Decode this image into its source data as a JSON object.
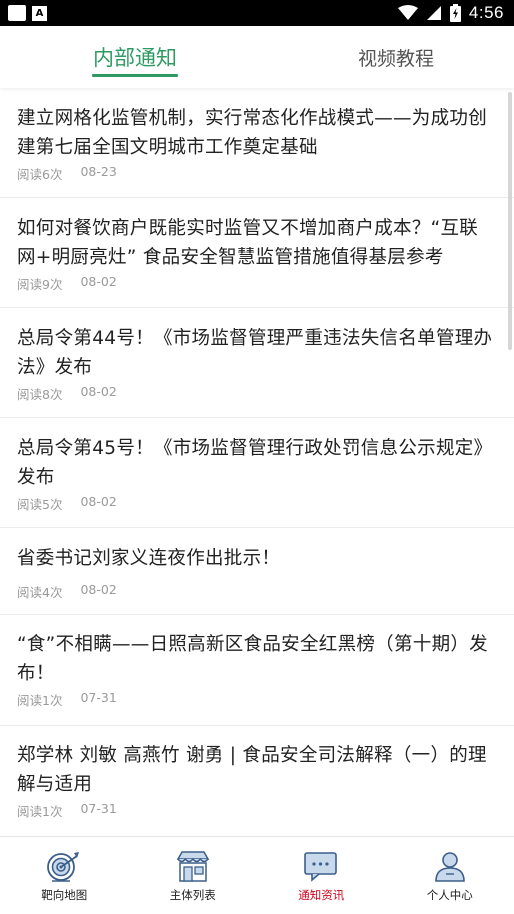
{
  "status_bar": {
    "time": "4:56",
    "notification_icon": "A"
  },
  "tabs": [
    {
      "label": "内部通知",
      "active": true
    },
    {
      "label": "视频教程",
      "active": false
    }
  ],
  "articles": [
    {
      "title": "建立网格化监管机制，实行常态化作战模式——为成功创建第七届全国文明城市工作奠定基础",
      "reads": "阅读6次",
      "date": "08-23"
    },
    {
      "title": "如何对餐饮商户既能实时监管又不增加商户成本？“互联网+明厨亮灶” 食品安全智慧监管措施值得基层参考",
      "reads": "阅读9次",
      "date": "08-02"
    },
    {
      "title": "总局令第44号！《市场监督管理严重违法失信名单管理办法》发布",
      "reads": "阅读8次",
      "date": "08-02"
    },
    {
      "title": "总局令第45号！《市场监督管理行政处罚信息公示规定》发布",
      "reads": "阅读5次",
      "date": "08-02"
    },
    {
      "title": "省委书记刘家义连夜作出批示！",
      "reads": "阅读4次",
      "date": "08-02"
    },
    {
      "title": "“食”不相瞒——日照高新区食品安全红黑榜（第十期）发布！",
      "reads": "阅读1次",
      "date": "07-31"
    },
    {
      "title": "郑学林 刘敏 高燕竹 谢勇 | 食品安全司法解释（一）的理解与适用",
      "reads": "阅读1次",
      "date": "07-31"
    }
  ],
  "bottom_nav": [
    {
      "label": "靶向地图",
      "icon": "target-map-icon",
      "active": false
    },
    {
      "label": "主体列表",
      "icon": "storefront-icon",
      "active": false
    },
    {
      "label": "通知资讯",
      "icon": "chat-bubble-icon",
      "active": true
    },
    {
      "label": "个人中心",
      "icon": "person-icon",
      "active": false
    }
  ],
  "colors": {
    "accent_green": "#2f9a63",
    "active_red": "#d4001a",
    "meta_gray": "#9a9a9a"
  }
}
